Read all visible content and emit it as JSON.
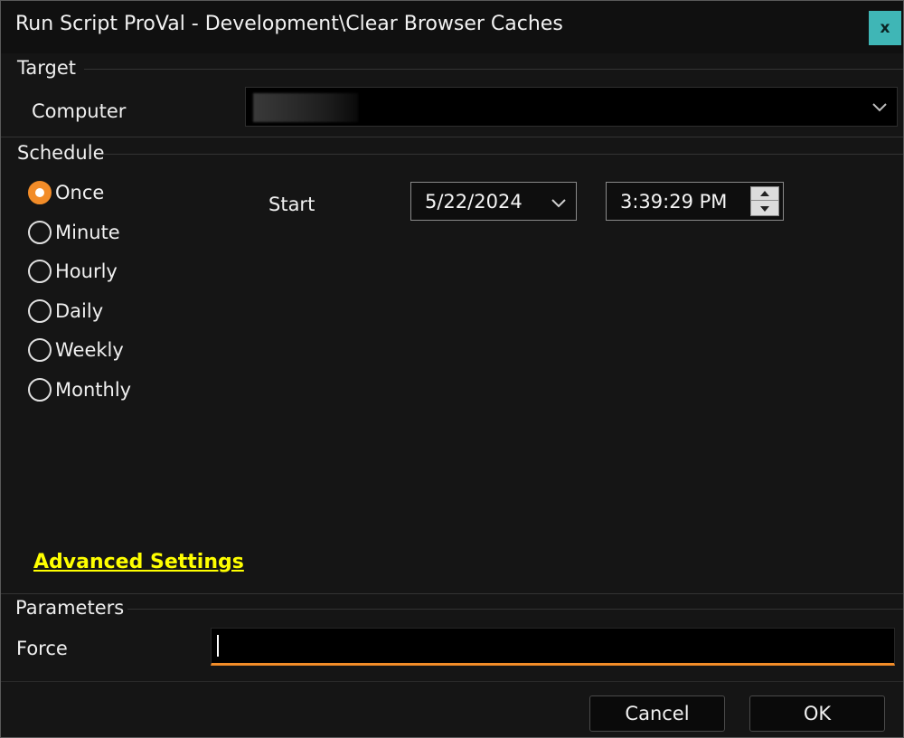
{
  "window": {
    "title": "Run Script ProVal - Development\\Clear Browser Caches",
    "close_label": "x"
  },
  "target": {
    "section_label": "Target",
    "computer_label": "Computer",
    "computer_value": ""
  },
  "schedule": {
    "section_label": "Schedule",
    "options": [
      {
        "label": "Once",
        "checked": true
      },
      {
        "label": "Minute",
        "checked": false
      },
      {
        "label": "Hourly",
        "checked": false
      },
      {
        "label": "Daily",
        "checked": false
      },
      {
        "label": "Weekly",
        "checked": false
      },
      {
        "label": "Monthly",
        "checked": false
      }
    ],
    "start_label": "Start",
    "start_date": "5/22/2024",
    "start_time": "3:39:29 PM",
    "advanced_settings_label": "Advanced Settings"
  },
  "parameters": {
    "section_label": "Parameters",
    "force_label": "Force",
    "force_value": ""
  },
  "buttons": {
    "cancel_label": "Cancel",
    "ok_label": "OK"
  },
  "colors": {
    "accent": "#f28c28",
    "link": "#ffff00",
    "close_button": "#3fb6b6",
    "background": "#151515"
  }
}
